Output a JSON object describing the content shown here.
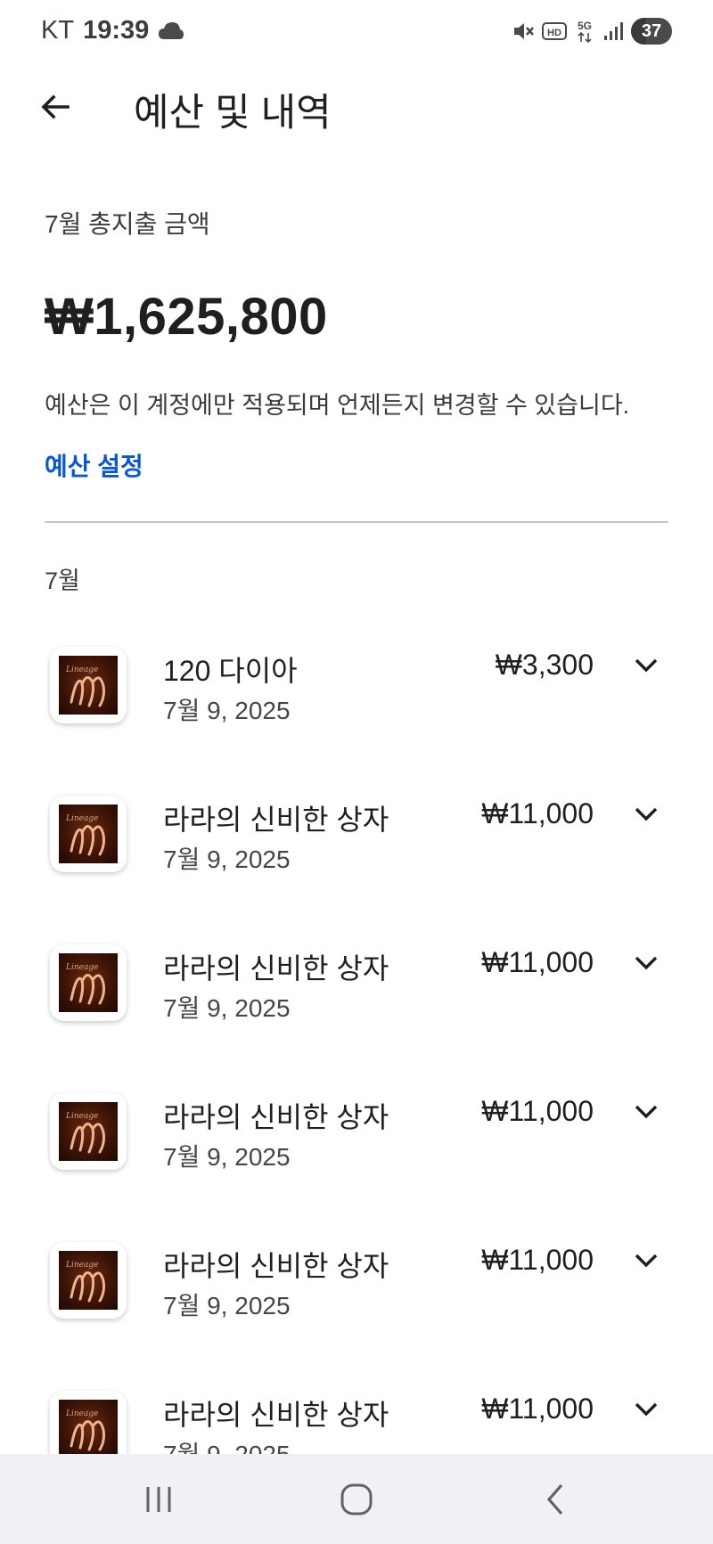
{
  "status_bar": {
    "carrier": "KT",
    "time": "19:39",
    "battery_level": "37",
    "battery_fraction": 0.37,
    "icons": [
      "cloud-icon",
      "mute-icon",
      "hd-icon",
      "5g-icon",
      "signal-icon",
      "battery-icon"
    ]
  },
  "header": {
    "title": "예산 및 내역",
    "back_icon": "arrow-left-icon"
  },
  "summary": {
    "label": "7월 총지출 금액",
    "total": "₩1,625,800",
    "note": "예산은 이 계정에만 적용되며 언제든지 변경할 수 있습니다.",
    "set_budget_link": "예산 설정"
  },
  "colors": {
    "link": "#0b57d0",
    "text": "#1f1f1f",
    "divider": "#c4c7c5",
    "nav_bg": "#eff1f7"
  },
  "section": {
    "month": "7월"
  },
  "transactions": [
    {
      "title": "120 다이아",
      "date": "7월 9, 2025",
      "amount": "₩3,300"
    },
    {
      "title": "라라의 신비한 상자",
      "date": "7월 9, 2025",
      "amount": "₩11,000"
    },
    {
      "title": "라라의 신비한 상자",
      "date": "7월 9, 2025",
      "amount": "₩11,000"
    },
    {
      "title": "라라의 신비한 상자",
      "date": "7월 9, 2025",
      "amount": "₩11,000"
    },
    {
      "title": "라라의 신비한 상자",
      "date": "7월 9, 2025",
      "amount": "₩11,000"
    },
    {
      "title": "라라의 신비한 상자",
      "date": "7월 9, 2025",
      "amount": "₩11,000"
    }
  ],
  "nav": {
    "icons": [
      "recent-apps-icon",
      "home-icon",
      "back-icon"
    ]
  }
}
